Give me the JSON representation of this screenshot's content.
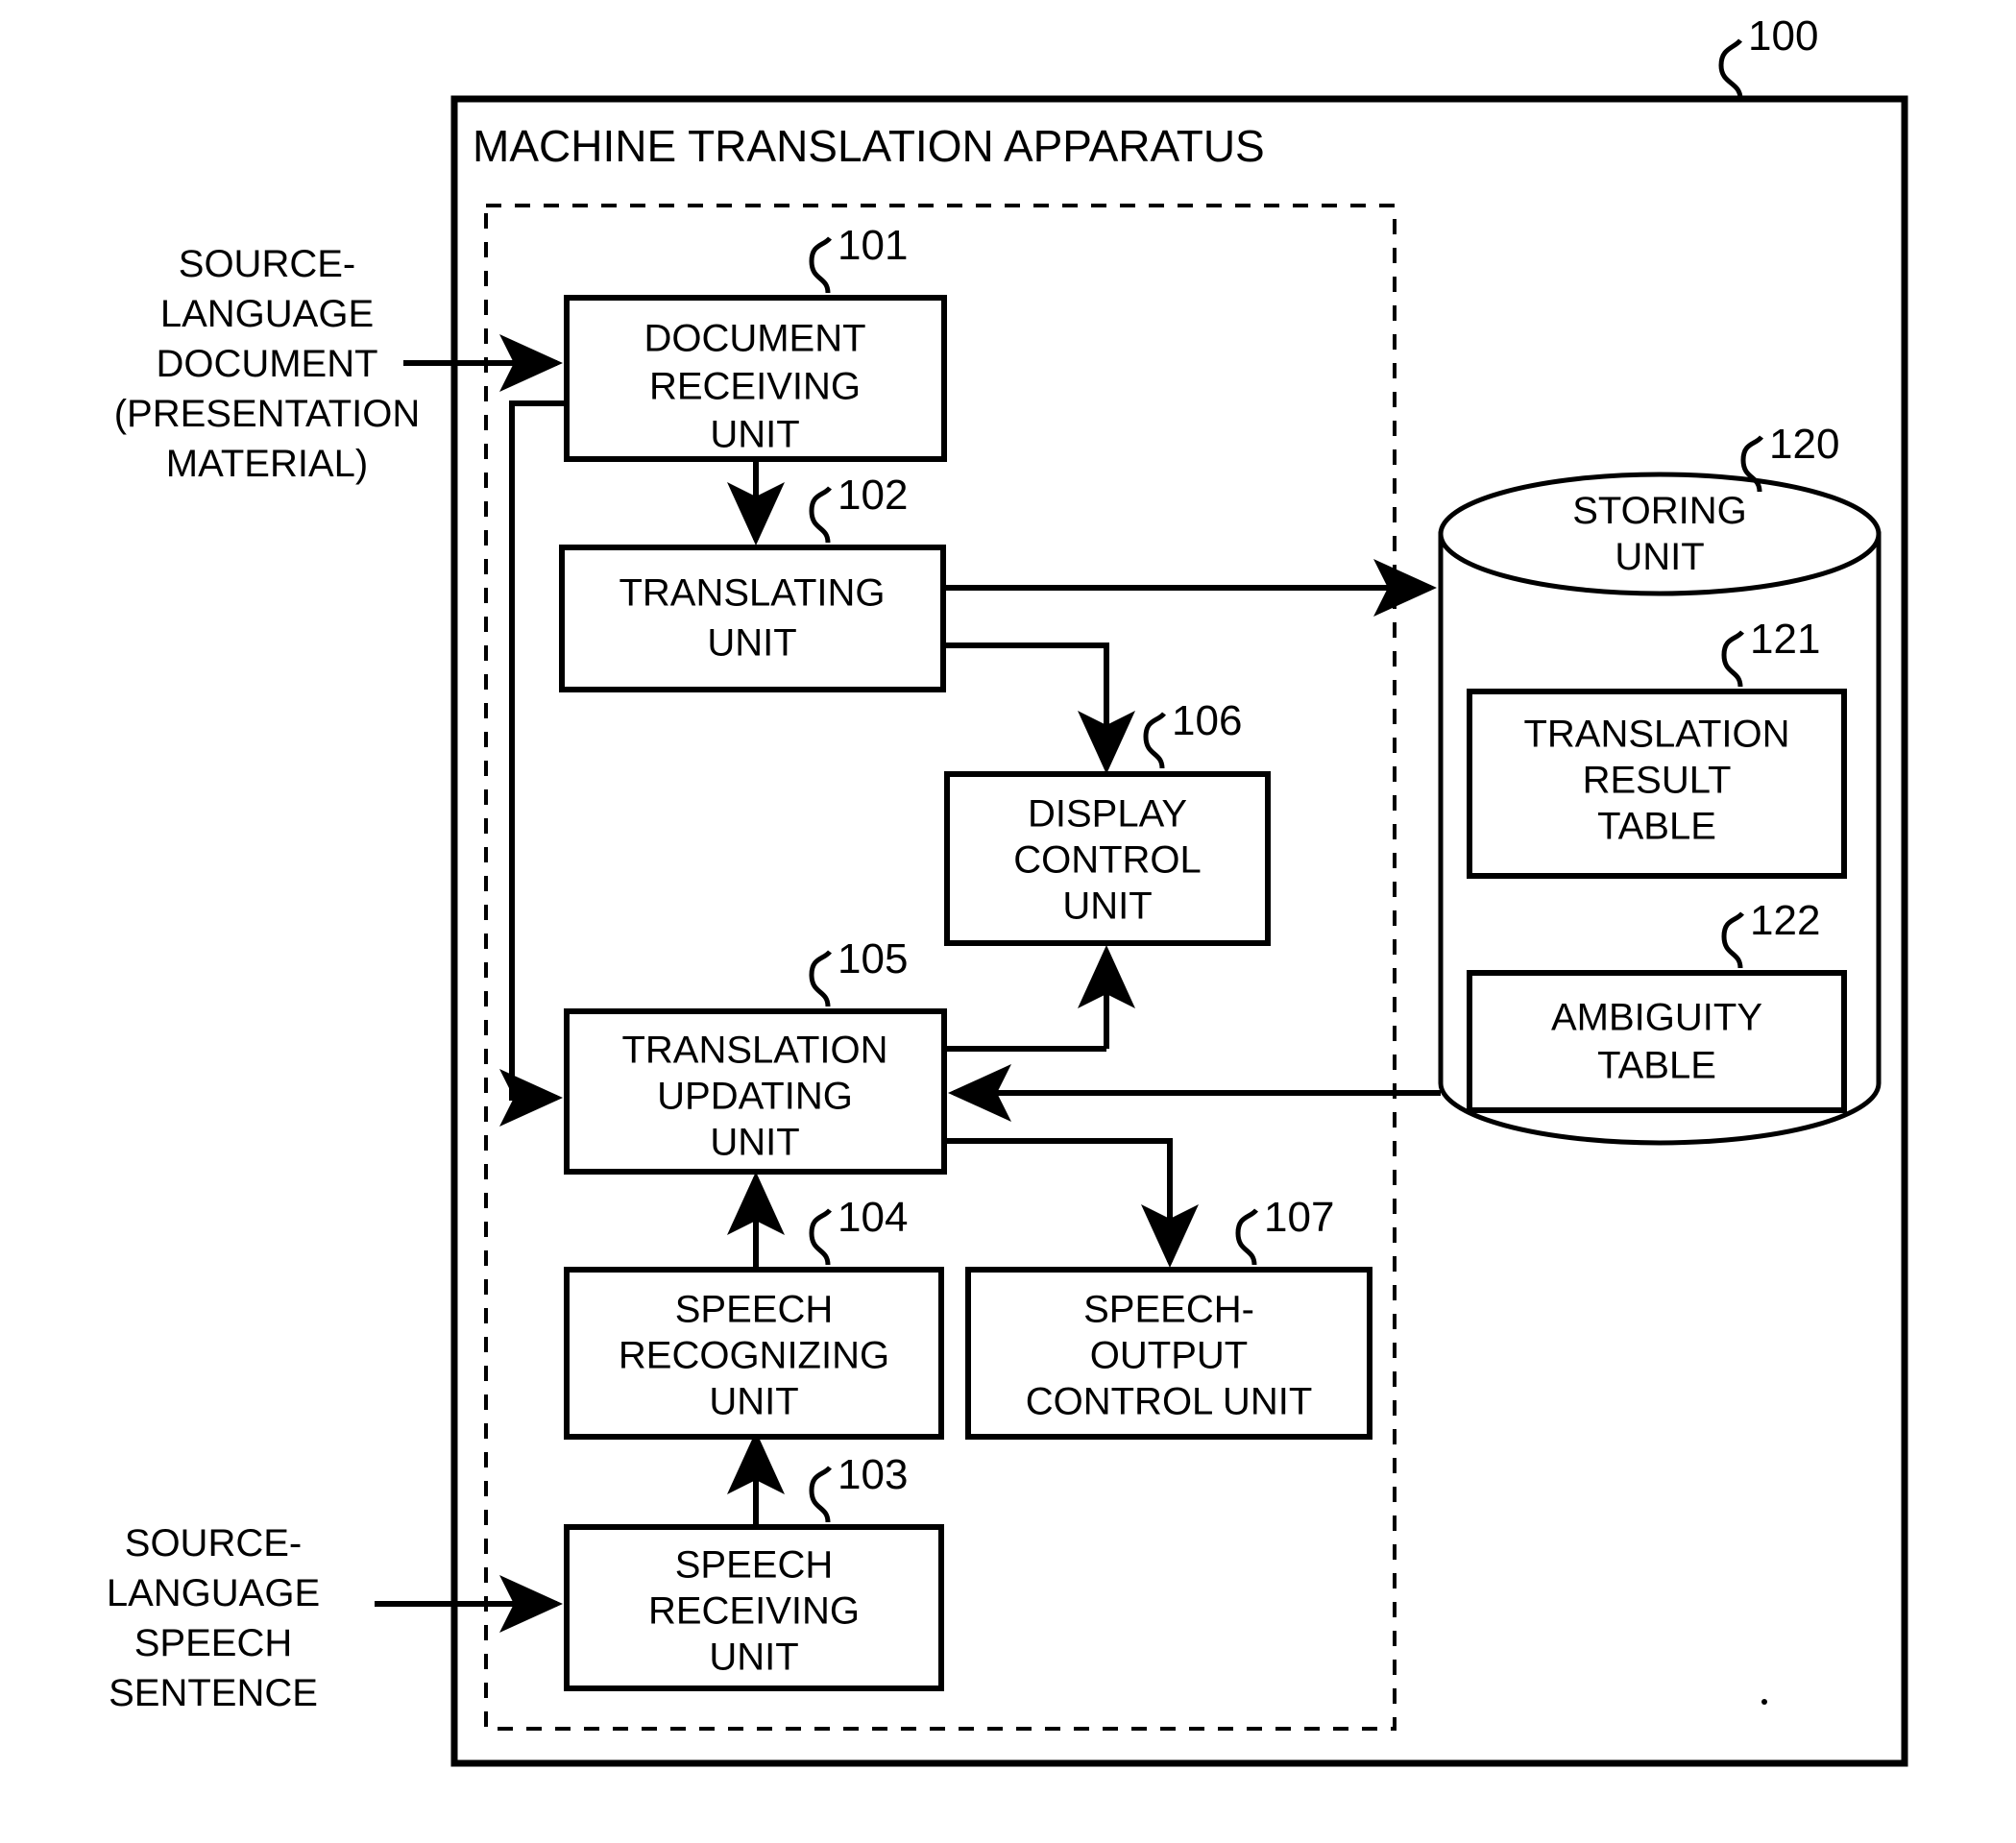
{
  "figure": {
    "apparatus_title": "MACHINE TRANSLATION APPARATUS",
    "apparatus_ref": "100"
  },
  "external_inputs": [
    {
      "name": "source-language-document",
      "lines": [
        "SOURCE-",
        "LANGUAGE",
        "DOCUMENT",
        "(PRESENTATION",
        "MATERIAL)"
      ]
    },
    {
      "name": "source-language-speech-sentence",
      "lines": [
        "SOURCE-",
        "LANGUAGE",
        "SPEECH",
        "SENTENCE"
      ]
    }
  ],
  "blocks": [
    {
      "id": "101",
      "name": "document-receiving-unit",
      "lines": [
        "DOCUMENT",
        "RECEIVING",
        "UNIT"
      ]
    },
    {
      "id": "102",
      "name": "translating-unit",
      "lines": [
        "TRANSLATING",
        "UNIT"
      ]
    },
    {
      "id": "106",
      "name": "display-control-unit",
      "lines": [
        "DISPLAY",
        "CONTROL",
        "UNIT"
      ]
    },
    {
      "id": "105",
      "name": "translation-updating-unit",
      "lines": [
        "TRANSLATION",
        "UPDATING",
        "UNIT"
      ]
    },
    {
      "id": "104",
      "name": "speech-recognizing-unit",
      "lines": [
        "SPEECH",
        "RECOGNIZING",
        "UNIT"
      ]
    },
    {
      "id": "107",
      "name": "speech-output-control-unit",
      "lines": [
        "SPEECH-",
        "OUTPUT",
        "CONTROL UNIT"
      ]
    },
    {
      "id": "103",
      "name": "speech-receiving-unit",
      "lines": [
        "SPEECH",
        "RECEIVING",
        "UNIT"
      ]
    }
  ],
  "storage": {
    "id": "120",
    "name": "storing-unit",
    "lines": [
      "STORING",
      "UNIT"
    ],
    "tables": [
      {
        "id": "121",
        "name": "translation-result-table",
        "lines": [
          "TRANSLATION",
          "RESULT",
          "TABLE"
        ]
      },
      {
        "id": "122",
        "name": "ambiguity-table",
        "lines": [
          "AMBIGUITY",
          "TABLE"
        ]
      }
    ]
  },
  "colors": {
    "stroke": "#000000",
    "background": "#ffffff"
  }
}
